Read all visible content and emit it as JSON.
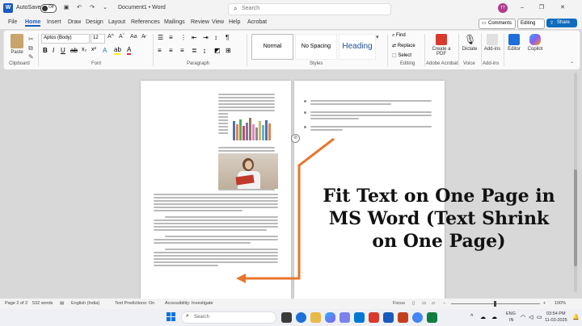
{
  "titlebar": {
    "autosave_label": "AutoSave",
    "autosave_state": "Off",
    "document_title": "Document1 • Word",
    "search_placeholder": "Search",
    "avatar_initials": "TT"
  },
  "menu": {
    "tabs": [
      "File",
      "Home",
      "Insert",
      "Draw",
      "Design",
      "Layout",
      "References",
      "Mailings",
      "Review",
      "View",
      "Help",
      "Acrobat"
    ],
    "active_tab": "Home",
    "comments_label": "Comments",
    "editing_label": "Editing",
    "share_label": "Share"
  },
  "ribbon": {
    "paste_label": "Paste",
    "clipboard_label": "Clipboard",
    "font_name": "Aptos (Body)",
    "font_size": "12",
    "font_group_label": "Font",
    "paragraph_label": "Paragraph",
    "styles": [
      "Normal",
      "No Spacing",
      "Heading"
    ],
    "styles_label": "Styles",
    "find_label": "Find",
    "replace_label": "Replace",
    "select_label": "Select",
    "editing_group_label": "Editing",
    "create_pdf_label": "Create a PDF",
    "adobe_label": "Adobe Acrobat",
    "dictate_label": "Dictate",
    "voice_label": "Voice",
    "addins_label": "Add-ins",
    "addins_group_label": "Add-ins",
    "editor_label": "Editor",
    "copilot_label": "Copilot"
  },
  "overlay": {
    "lines": [
      "Fit Text on One Page in",
      "MS Word (Text Shrink",
      "on One Page)"
    ]
  },
  "status": {
    "page": "Page 2 of 2",
    "words": "532 words",
    "language": "English (India)",
    "predictions": "Text Predictions: On",
    "accessibility": "Accessibility: Investigate",
    "focus": "Focus",
    "zoom": "100%"
  },
  "taskbar": {
    "search_placeholder": "Search",
    "lang_top": "ENG",
    "lang_bottom": "IN",
    "time": "03:54 PM",
    "date": "11-03-2025"
  },
  "colors": {
    "word_blue": "#185abd",
    "accent_orange": "#e8762d",
    "share_blue": "#0f6cbd"
  }
}
